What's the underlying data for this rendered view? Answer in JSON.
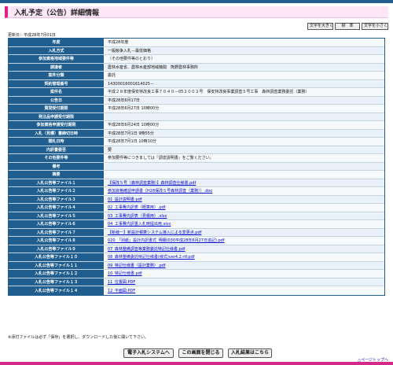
{
  "title": "入札予定（公告）詳細情報",
  "size_buttons": [
    "文字を大きく",
    "標　準",
    "文字を小さく"
  ],
  "updated": "更新日：平成28年7月01日",
  "rows": [
    {
      "label": "年度",
      "value": "平成28年度"
    },
    {
      "label": "入札方式",
      "value": "一般競争入札－最低価格"
    },
    {
      "label": "参加資格地域要件等",
      "value": "（その他要件等のとおり）"
    },
    {
      "label": "調達者",
      "value": "農林水産省、農林水産部地域機関　熊野農林事務所"
    },
    {
      "label": "案件分類",
      "value": "委託"
    },
    {
      "label": "契約管理番号",
      "value": "14300016001614025－"
    },
    {
      "label": "案件名",
      "value": "平成２８年度保安林改良工事７０４０－05２００２号　保安林改良事業調査５号工事　森林調査業務委託（業務）"
    },
    {
      "label": "公告日",
      "value": "平成28年6月17日"
    },
    {
      "label": "質問受付期限",
      "value": "平成28年6月27日 10時00分"
    },
    {
      "label": "発注品申請受付期限",
      "value": ""
    },
    {
      "label": "参加資格申請受付期限",
      "value": "平成28年6月24日 10時00分"
    },
    {
      "label": "入札（見積）書締切日時",
      "value": "平成28年7月1日 9時55分"
    },
    {
      "label": "開札日時",
      "value": "平成28年7月1日 10時10分"
    },
    {
      "label": "内訳書要否",
      "value": "要"
    },
    {
      "label": "その他要件等",
      "value": "参加要件等につきましては『調達説明書』をご覧ください。"
    },
    {
      "label": "備考",
      "value": ""
    },
    {
      "label": "摘要",
      "value": ""
    },
    {
      "label": "入札公告等ファイル１",
      "value": "【保改５号（森林調査業務）】森林調査仕様書.pdf",
      "link": true
    },
    {
      "label": "入札公告等ファイル２",
      "value": "参加資格確認申請書（H28保改５号森林調査（業務））.doc",
      "link": true
    },
    {
      "label": "入札公告等ファイル３",
      "value": "01_設計説明書.pdf",
      "link": true
    },
    {
      "label": "入札公告等ファイル４",
      "value": "02_工事費内訳表（概算用）.pdf",
      "link": true
    },
    {
      "label": "入札公告等ファイル５",
      "value": "03_工事費内訳表（見積用）.xlsx",
      "link": true
    },
    {
      "label": "入札公告等ファイル６",
      "value": "04_工事費内訳書入札時提出用.xlsx",
      "link": true
    },
    {
      "label": "入札公告等ファイル７",
      "value": "【新様一】新設計積算システム導入による変更点.pdf",
      "link": true
    },
    {
      "label": "入札公告等ファイル８",
      "value": "020_「別紙」設計内訳書式_明細(030平成28年6月27日追記).pdf",
      "link": true
    },
    {
      "label": "入札公告等ファイル９",
      "value": "07_森林整備調査等業務委託特記仕様書.pdf",
      "link": true
    },
    {
      "label": "入札公告等ファイル１０",
      "value": "08_森林整備委託特記仕様書(様式)ver4.2.rtf.pdf",
      "link": true
    },
    {
      "label": "入札公告等ファイル１１",
      "value": "09_特記仕様書（設計業務）.pdf",
      "link": true
    },
    {
      "label": "入札公告等ファイル１２",
      "value": "10_特記仕様書.pdf",
      "link": true
    },
    {
      "label": "入札公告等ファイル１３",
      "value": "11_位置図.PDF",
      "link": true
    },
    {
      "label": "入札公告等ファイル１４",
      "value": "12_平面図.PDF",
      "link": true
    }
  ],
  "note": "※添付ファイルは必ず「保存」を選択し、ダウンロードした後に開いて下さい。",
  "buttons": [
    "電子入札システムへ",
    "この画面を閉じる",
    "入札結果はこちら"
  ],
  "page_top": "△ページトップへ"
}
